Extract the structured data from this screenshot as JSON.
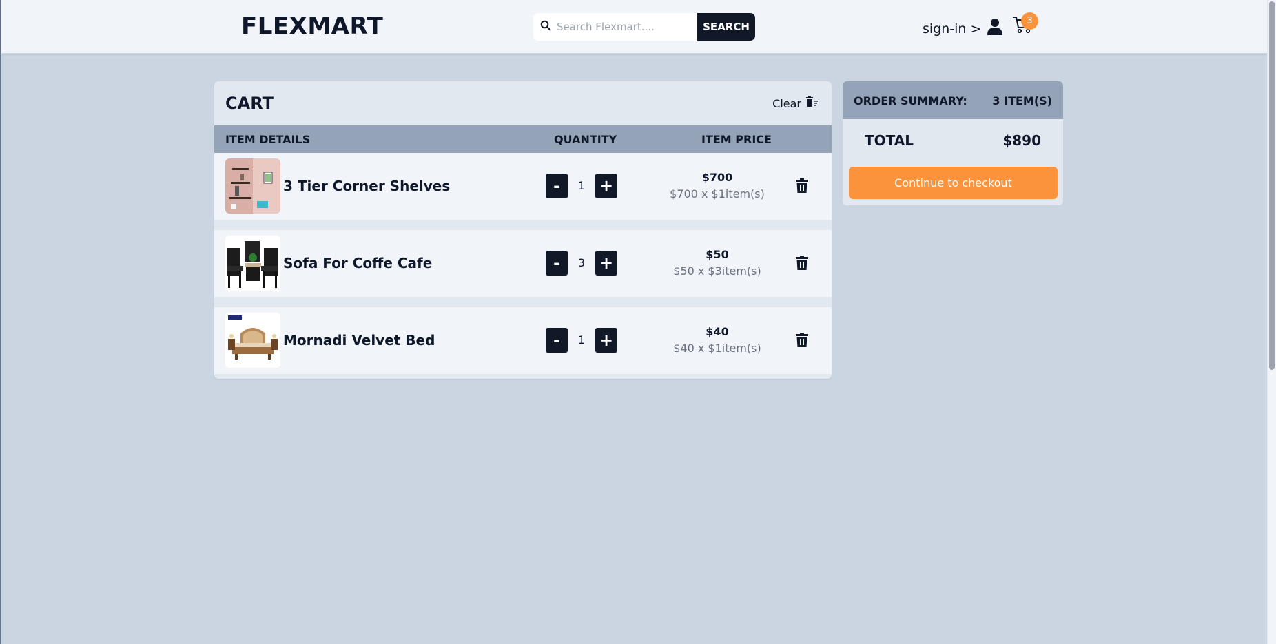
{
  "header": {
    "logo": "FLEXMART",
    "search_placeholder": "Search Flexmart....",
    "search_button": "SEARCH",
    "signin_label": "sign-in >",
    "cart_count": "3"
  },
  "cart": {
    "title": "CART",
    "clear_label": "Clear",
    "columns": {
      "details": "ITEM DETAILS",
      "quantity": "QUANTITY",
      "price": "ITEM PRICE"
    },
    "items": [
      {
        "name": "3 Tier Corner Shelves",
        "quantity": "1",
        "price": "$700",
        "price_detail": "$700 x $1item(s)",
        "minus": "-",
        "plus": "+"
      },
      {
        "name": "Sofa For Coffe Cafe",
        "quantity": "3",
        "price": "$50",
        "price_detail": "$50 x $3item(s)",
        "minus": "-",
        "plus": "+"
      },
      {
        "name": "Mornadi Velvet Bed",
        "quantity": "1",
        "price": "$40",
        "price_detail": "$40 x $1item(s)",
        "minus": "-",
        "plus": "+"
      }
    ]
  },
  "summary": {
    "label": "ORDER SUMMARY:",
    "count": "3 ITEM(S)",
    "total_label": "TOTAL",
    "total_value": "$890",
    "checkout_label": "Continue to checkout"
  },
  "colors": {
    "accent": "#fb923c",
    "dark": "#111827",
    "page_bg": "#cbd5e1",
    "table_head": "#94a3b8"
  }
}
